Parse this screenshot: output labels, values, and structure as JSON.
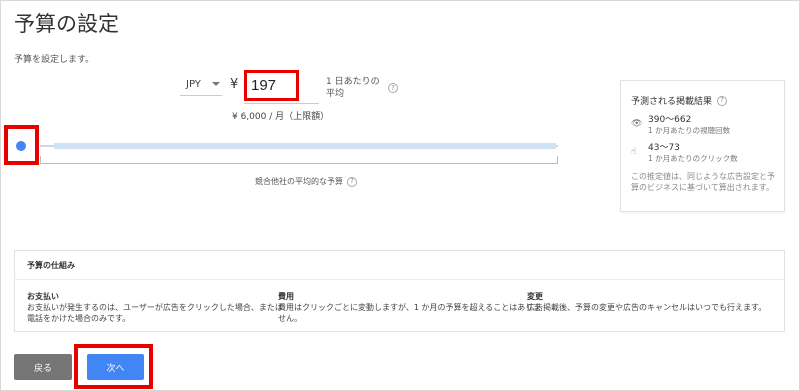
{
  "page": {
    "title": "予算の設定",
    "subtitle": "予算を設定します。"
  },
  "budget": {
    "currency": "JPY",
    "currency_symbol": "¥",
    "amount": "197",
    "per_day_label_line1": "1 日あたりの",
    "per_day_label_line2": "平均",
    "monthly_label": "¥ 6,000 / 月（上限額）"
  },
  "slider": {
    "competitor_label": "競合他社の平均的な予算"
  },
  "forecast": {
    "title": "予測される掲載結果",
    "views_value": "390〜662",
    "views_label": "1 か月あたりの視聴回数",
    "clicks_value": "43〜73",
    "clicks_label": "1 か月あたりのクリック数",
    "note": "この推定値は、同じような広告設定と予算のビジネスに基づいて算出されます。"
  },
  "mechanism": {
    "title": "予算の仕組み",
    "payment_heading": "お支払い",
    "payment_text": "お支払いが発生するのは、ユーザーが広告をクリックした場合、または電話をかけた場合のみです。",
    "cost_heading": "費用",
    "cost_text": "費用はクリックごとに変動しますが、1 か月の予算を超えることはありません。",
    "change_heading": "変更",
    "change_text": "広告掲載後、予算の変更や広告のキャンセルはいつでも行えます。"
  },
  "buttons": {
    "back_label": "戻る",
    "next_label": "次へ"
  },
  "icons": {
    "help": "?",
    "views": "👁",
    "clicks": "☝"
  },
  "colors": {
    "highlight": "#e80000",
    "primary": "#4285f4",
    "secondary": "#757575"
  }
}
